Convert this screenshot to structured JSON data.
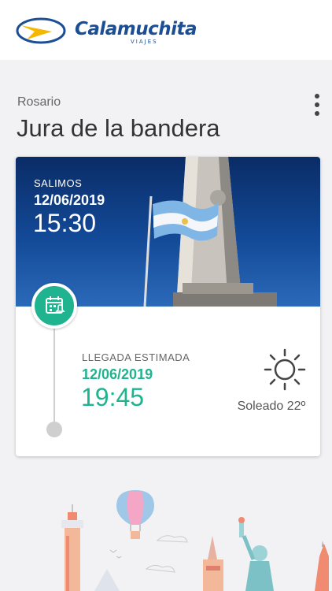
{
  "header": {
    "brand_name": "Calamuchita",
    "brand_subtitle": "VIAJES",
    "icon": "brand-logo-icon"
  },
  "trip": {
    "city": "Rosario",
    "title": "Jura de la bandera",
    "menu_icon": "more-vertical-icon"
  },
  "departure": {
    "label": "SALIMOS",
    "date": "12/06/2019",
    "time": "15:30"
  },
  "arrival": {
    "label": "LLEGADA ESTIMADA",
    "date": "12/06/2019",
    "time": "19:45"
  },
  "weather": {
    "text": "Soleado 22º",
    "icon": "sun-icon"
  },
  "colors": {
    "brand_blue": "#1b4e95",
    "accent_green": "#1fb38f",
    "logo_yellow": "#f5b700",
    "background": "#f2f2f4"
  }
}
